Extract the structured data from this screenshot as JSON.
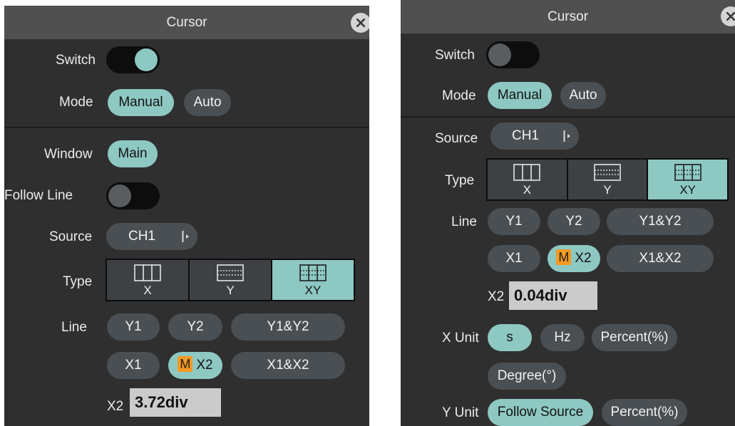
{
  "left": {
    "title": "Cursor",
    "switch_label": "Switch",
    "mode_label": "Mode",
    "mode_options": [
      "Manual",
      "Auto"
    ],
    "window_label": "Window",
    "window_value": "Main",
    "follow_label": "Follow Line",
    "source_label": "Source",
    "source_value": "CH1",
    "type_label": "Type",
    "type_options": [
      "X",
      "Y",
      "XY"
    ],
    "line_label": "Line",
    "line_row1": [
      "Y1",
      "Y2",
      "Y1&Y2"
    ],
    "line_row2": [
      "X1",
      "X2",
      "X1&X2"
    ],
    "m_badge": "M",
    "x2_label": "X2",
    "x2_value": "3.72div"
  },
  "right": {
    "title": "Cursor",
    "switch_label": "Switch",
    "mode_label": "Mode",
    "mode_options": [
      "Manual",
      "Auto"
    ],
    "source_label": "Source",
    "source_value": "CH1",
    "type_label": "Type",
    "type_options": [
      "X",
      "Y",
      "XY"
    ],
    "line_label": "Line",
    "line_row1": [
      "Y1",
      "Y2",
      "Y1&Y2"
    ],
    "line_row2": [
      "X1",
      "X2",
      "X1&X2"
    ],
    "m_badge": "M",
    "x2_label": "X2",
    "x2_value": "0.04div",
    "xunit_label": "X Unit",
    "xunit_options": [
      "s",
      "Hz",
      "Percent(%)",
      "Degree(°)"
    ],
    "yunit_label": "Y Unit",
    "yunit_options": [
      "Follow Source",
      "Percent(%)"
    ]
  },
  "state": {
    "left_switch_on": true,
    "left_follow_line_on": false,
    "right_switch_on": false,
    "left_mode": "Manual",
    "right_mode": "Manual",
    "left_type": "XY",
    "right_type": "XY",
    "right_xunit": "s",
    "right_yunit": "Follow Source"
  },
  "colors": {
    "panel_bg": "#2f2f2f",
    "titlebar_bg": "#505050",
    "accent": "#8ec8c2",
    "pill_bg": "#4a4f53",
    "badge": "#f59a24",
    "value_box": "#cbcbcb"
  },
  "icons": {
    "close": "close-icon",
    "source_arrow": "submenu-arrow-icon",
    "type_x": "vertical-cursors-icon",
    "type_y": "horizontal-cursors-icon",
    "type_xy": "grid-cursors-icon"
  }
}
